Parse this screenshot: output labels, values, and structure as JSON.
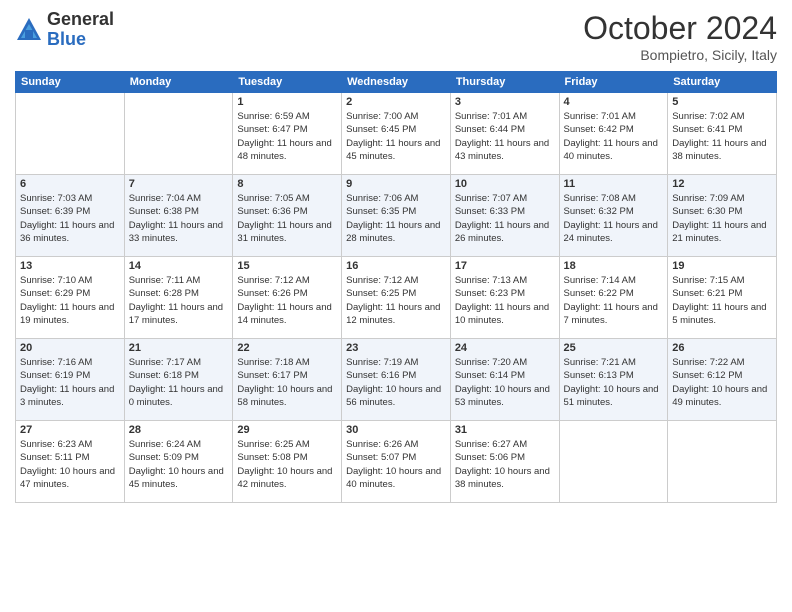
{
  "logo": {
    "general": "General",
    "blue": "Blue"
  },
  "header": {
    "month": "October 2024",
    "location": "Bompietro, Sicily, Italy"
  },
  "days_of_week": [
    "Sunday",
    "Monday",
    "Tuesday",
    "Wednesday",
    "Thursday",
    "Friday",
    "Saturday"
  ],
  "weeks": [
    [
      {
        "day": "",
        "content": ""
      },
      {
        "day": "",
        "content": ""
      },
      {
        "day": "1",
        "content": "Sunrise: 6:59 AM\nSunset: 6:47 PM\nDaylight: 11 hours and 48 minutes."
      },
      {
        "day": "2",
        "content": "Sunrise: 7:00 AM\nSunset: 6:45 PM\nDaylight: 11 hours and 45 minutes."
      },
      {
        "day": "3",
        "content": "Sunrise: 7:01 AM\nSunset: 6:44 PM\nDaylight: 11 hours and 43 minutes."
      },
      {
        "day": "4",
        "content": "Sunrise: 7:01 AM\nSunset: 6:42 PM\nDaylight: 11 hours and 40 minutes."
      },
      {
        "day": "5",
        "content": "Sunrise: 7:02 AM\nSunset: 6:41 PM\nDaylight: 11 hours and 38 minutes."
      }
    ],
    [
      {
        "day": "6",
        "content": "Sunrise: 7:03 AM\nSunset: 6:39 PM\nDaylight: 11 hours and 36 minutes."
      },
      {
        "day": "7",
        "content": "Sunrise: 7:04 AM\nSunset: 6:38 PM\nDaylight: 11 hours and 33 minutes."
      },
      {
        "day": "8",
        "content": "Sunrise: 7:05 AM\nSunset: 6:36 PM\nDaylight: 11 hours and 31 minutes."
      },
      {
        "day": "9",
        "content": "Sunrise: 7:06 AM\nSunset: 6:35 PM\nDaylight: 11 hours and 28 minutes."
      },
      {
        "day": "10",
        "content": "Sunrise: 7:07 AM\nSunset: 6:33 PM\nDaylight: 11 hours and 26 minutes."
      },
      {
        "day": "11",
        "content": "Sunrise: 7:08 AM\nSunset: 6:32 PM\nDaylight: 11 hours and 24 minutes."
      },
      {
        "day": "12",
        "content": "Sunrise: 7:09 AM\nSunset: 6:30 PM\nDaylight: 11 hours and 21 minutes."
      }
    ],
    [
      {
        "day": "13",
        "content": "Sunrise: 7:10 AM\nSunset: 6:29 PM\nDaylight: 11 hours and 19 minutes."
      },
      {
        "day": "14",
        "content": "Sunrise: 7:11 AM\nSunset: 6:28 PM\nDaylight: 11 hours and 17 minutes."
      },
      {
        "day": "15",
        "content": "Sunrise: 7:12 AM\nSunset: 6:26 PM\nDaylight: 11 hours and 14 minutes."
      },
      {
        "day": "16",
        "content": "Sunrise: 7:12 AM\nSunset: 6:25 PM\nDaylight: 11 hours and 12 minutes."
      },
      {
        "day": "17",
        "content": "Sunrise: 7:13 AM\nSunset: 6:23 PM\nDaylight: 11 hours and 10 minutes."
      },
      {
        "day": "18",
        "content": "Sunrise: 7:14 AM\nSunset: 6:22 PM\nDaylight: 11 hours and 7 minutes."
      },
      {
        "day": "19",
        "content": "Sunrise: 7:15 AM\nSunset: 6:21 PM\nDaylight: 11 hours and 5 minutes."
      }
    ],
    [
      {
        "day": "20",
        "content": "Sunrise: 7:16 AM\nSunset: 6:19 PM\nDaylight: 11 hours and 3 minutes."
      },
      {
        "day": "21",
        "content": "Sunrise: 7:17 AM\nSunset: 6:18 PM\nDaylight: 11 hours and 0 minutes."
      },
      {
        "day": "22",
        "content": "Sunrise: 7:18 AM\nSunset: 6:17 PM\nDaylight: 10 hours and 58 minutes."
      },
      {
        "day": "23",
        "content": "Sunrise: 7:19 AM\nSunset: 6:16 PM\nDaylight: 10 hours and 56 minutes."
      },
      {
        "day": "24",
        "content": "Sunrise: 7:20 AM\nSunset: 6:14 PM\nDaylight: 10 hours and 53 minutes."
      },
      {
        "day": "25",
        "content": "Sunrise: 7:21 AM\nSunset: 6:13 PM\nDaylight: 10 hours and 51 minutes."
      },
      {
        "day": "26",
        "content": "Sunrise: 7:22 AM\nSunset: 6:12 PM\nDaylight: 10 hours and 49 minutes."
      }
    ],
    [
      {
        "day": "27",
        "content": "Sunrise: 6:23 AM\nSunset: 5:11 PM\nDaylight: 10 hours and 47 minutes."
      },
      {
        "day": "28",
        "content": "Sunrise: 6:24 AM\nSunset: 5:09 PM\nDaylight: 10 hours and 45 minutes."
      },
      {
        "day": "29",
        "content": "Sunrise: 6:25 AM\nSunset: 5:08 PM\nDaylight: 10 hours and 42 minutes."
      },
      {
        "day": "30",
        "content": "Sunrise: 6:26 AM\nSunset: 5:07 PM\nDaylight: 10 hours and 40 minutes."
      },
      {
        "day": "31",
        "content": "Sunrise: 6:27 AM\nSunset: 5:06 PM\nDaylight: 10 hours and 38 minutes."
      },
      {
        "day": "",
        "content": ""
      },
      {
        "day": "",
        "content": ""
      }
    ]
  ]
}
